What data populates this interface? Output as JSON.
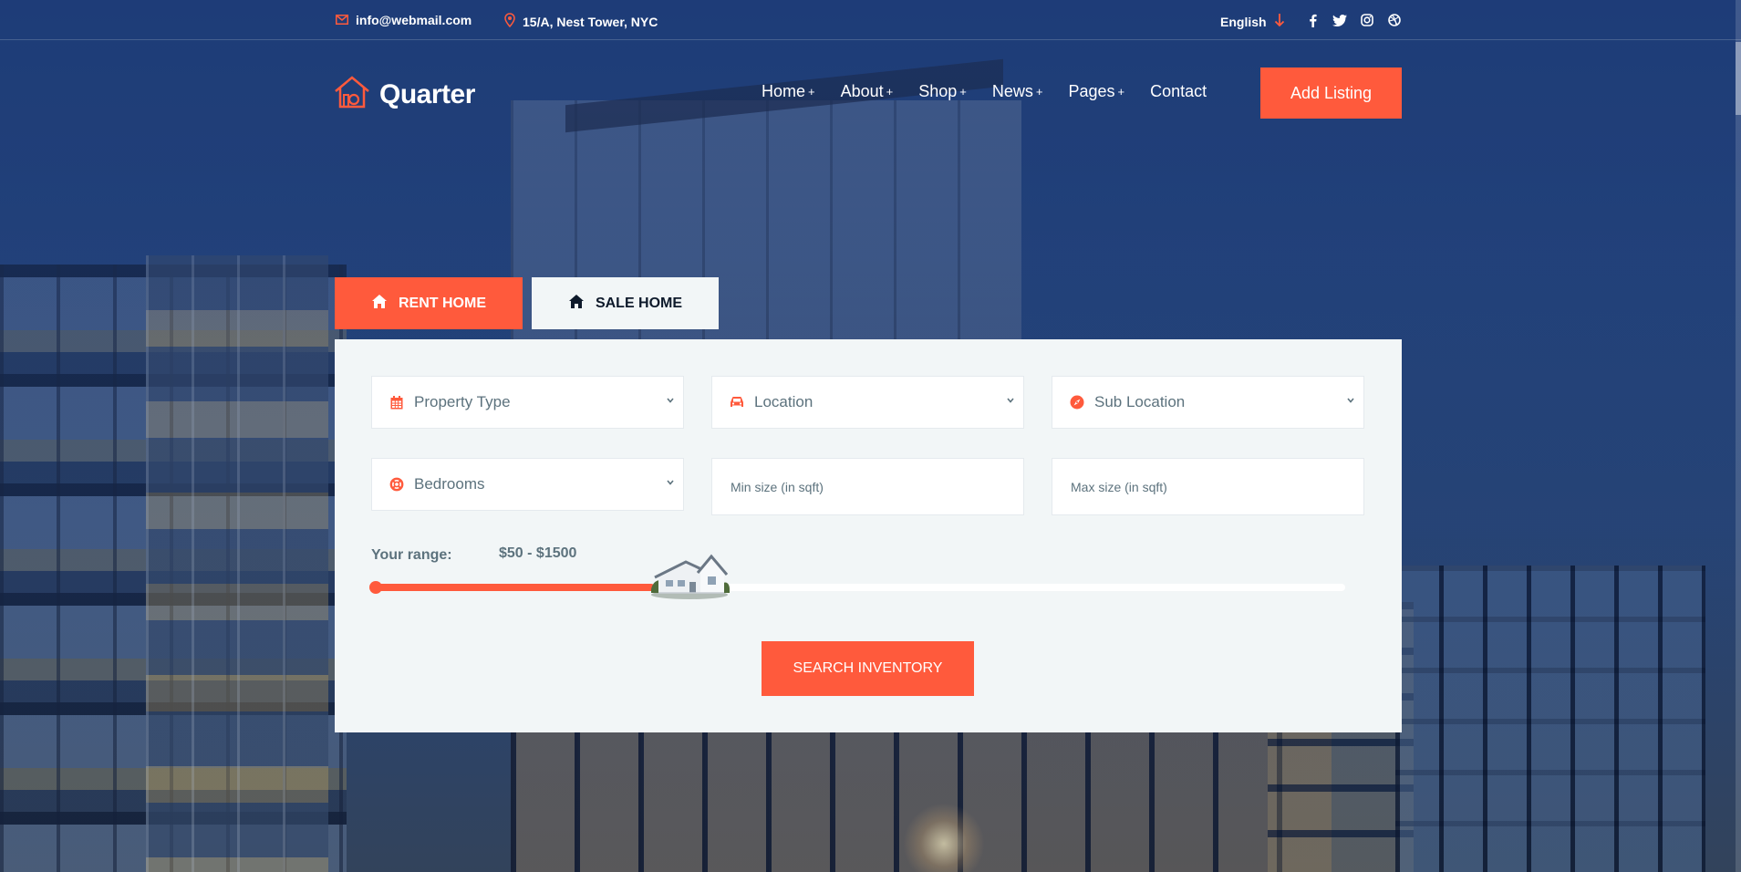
{
  "topbar": {
    "email": "info@webmail.com",
    "address": "15/A, Nest Tower, NYC",
    "language": "English",
    "social_icons": [
      "facebook-icon",
      "twitter-icon",
      "instagram-icon",
      "dribbble-icon"
    ]
  },
  "header": {
    "logo_text": "Quarter",
    "nav": [
      {
        "label": "Home",
        "has_submenu": true
      },
      {
        "label": "About",
        "has_submenu": true
      },
      {
        "label": "Shop",
        "has_submenu": true
      },
      {
        "label": "News",
        "has_submenu": true
      },
      {
        "label": "Pages",
        "has_submenu": true
      },
      {
        "label": "Contact",
        "has_submenu": false
      }
    ],
    "plus_symbol": "+",
    "cta_label": "Add Listing"
  },
  "tabs": [
    {
      "label": "RENT HOME",
      "active": true,
      "icon": "home-icon"
    },
    {
      "label": "SALE HOME",
      "active": false,
      "icon": "home-icon"
    }
  ],
  "search": {
    "selects": {
      "property_type": "Property Type",
      "location": "Location",
      "sub_location": "Sub Location",
      "bedrooms": "Bedrooms"
    },
    "inputs": {
      "min_size_placeholder": "Min size (in sqft)",
      "max_size_placeholder": "Max size (in sqft)"
    },
    "range_label": "Your range:",
    "range_value": "$50 - $1500",
    "range_fill_fraction": 0.29,
    "submit_label": "SEARCH INVENTORY"
  },
  "colors": {
    "accent": "#ff5a3c",
    "panel_bg": "#f2f6f7",
    "dark_text": "#0e1a2b",
    "muted_text": "#5c727d"
  }
}
